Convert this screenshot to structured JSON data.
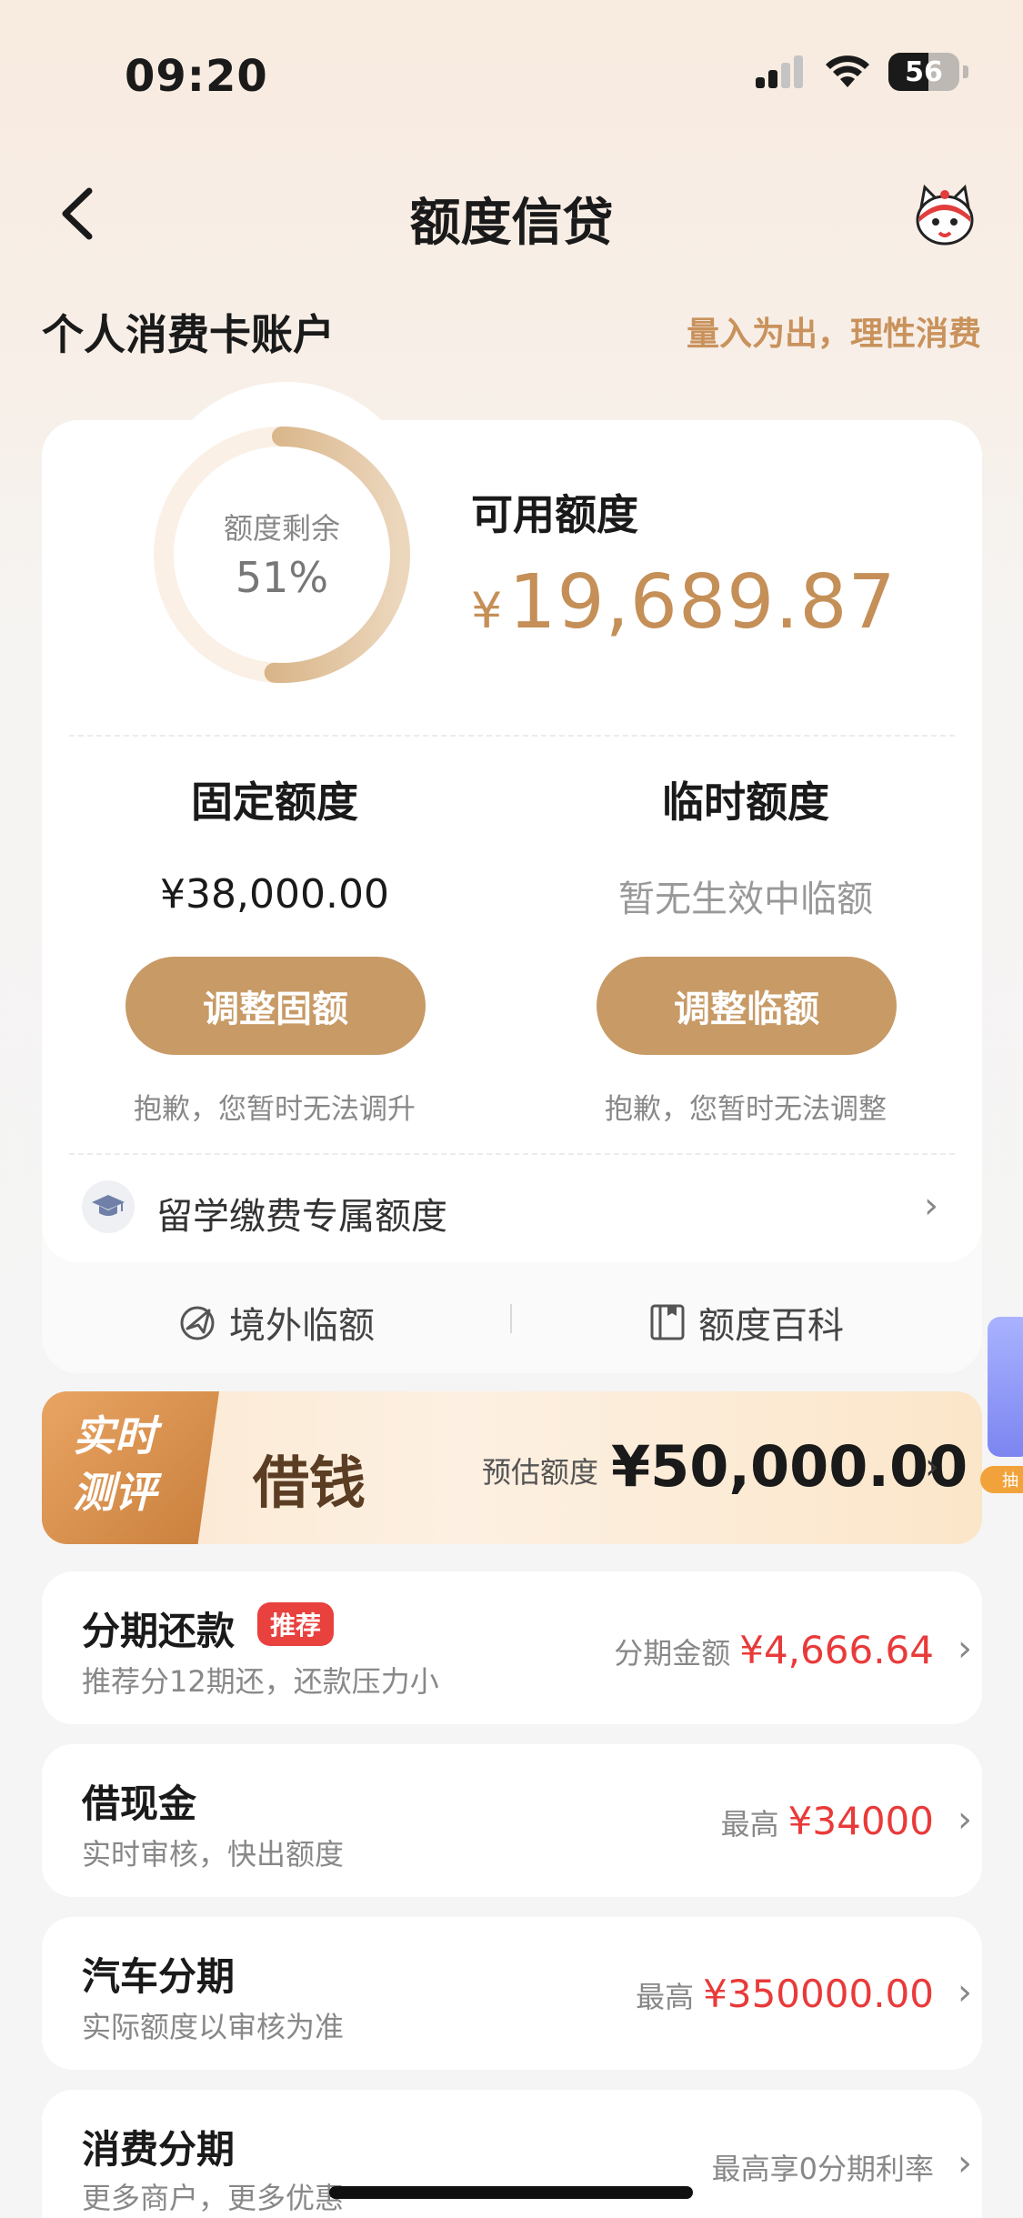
{
  "status_bar": {
    "time": "09:20",
    "battery": "56"
  },
  "nav": {
    "title": "额度信贷"
  },
  "account": {
    "title": "个人消费卡账户",
    "slogan": "量入为出，理性消费"
  },
  "quota": {
    "remaining_label": "额度剩余",
    "remaining_pct": "51%",
    "remaining_fraction": 0.51,
    "available_label": "可用额度",
    "available_currency": "¥",
    "available_amount": "19,689.87",
    "accent_color": "#c58f58"
  },
  "fixed": {
    "title": "固定额度",
    "value": "¥38,000.00",
    "button": "调整固额",
    "note": "抱歉，您暂时无法调升"
  },
  "temp": {
    "title": "临时额度",
    "value": "暂无生效中临额",
    "button": "调整临额",
    "note": "抱歉，您暂时无法调整"
  },
  "study": {
    "label": "留学缴费专属额度"
  },
  "footer_links": [
    {
      "label": "境外临额"
    },
    {
      "label": "额度百科"
    }
  ],
  "banner": {
    "tag_line1": "实时",
    "tag_line2": "测评",
    "title": "借钱",
    "est_label": "预估额度",
    "est_amount": "¥50,000.00"
  },
  "products": [
    {
      "title": "分期还款",
      "badge": "推荐",
      "subtitle": "推荐分12期还，还款压力小",
      "right_label": "分期金额",
      "right_amount": "¥4,666.64"
    },
    {
      "title": "借现金",
      "subtitle": "实时审核，快出额度",
      "right_label": "最高",
      "right_amount": "¥34000"
    },
    {
      "title": "汽车分期",
      "subtitle": "实际额度以审核为准",
      "right_label": "最高",
      "right_amount": "¥350000.00"
    },
    {
      "title": "消费分期",
      "subtitle": "更多商户，更多优惠",
      "right_label": "最高享0分期利率",
      "right_amount": ""
    }
  ],
  "side_widget": {
    "label": "抽"
  }
}
